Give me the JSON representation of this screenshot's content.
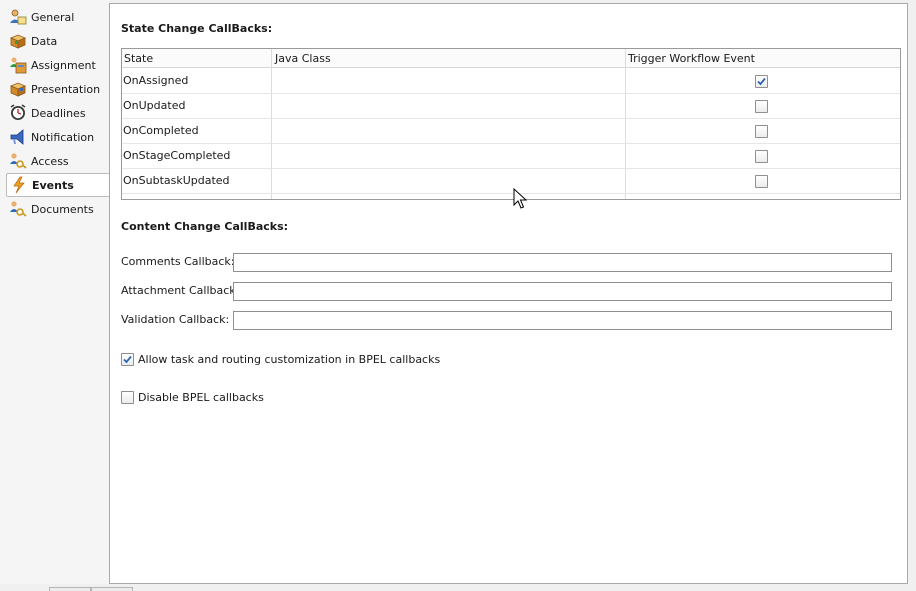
{
  "sidebar": {
    "items": [
      {
        "label": "General",
        "icon": "general-icon"
      },
      {
        "label": "Data",
        "icon": "data-icon"
      },
      {
        "label": "Assignment",
        "icon": "assignment-icon"
      },
      {
        "label": "Presentation",
        "icon": "presentation-icon"
      },
      {
        "label": "Deadlines",
        "icon": "deadlines-icon"
      },
      {
        "label": "Notification",
        "icon": "notification-icon"
      },
      {
        "label": "Access",
        "icon": "access-icon"
      },
      {
        "label": "Events",
        "icon": "events-icon",
        "active": true
      },
      {
        "label": "Documents",
        "icon": "documents-icon"
      }
    ]
  },
  "state_callbacks": {
    "title": "State Change CallBacks:",
    "columns": [
      "State",
      "Java Class",
      "Trigger Workflow Event"
    ],
    "rows": [
      {
        "state": "OnAssigned",
        "java_class": "",
        "trigger": true
      },
      {
        "state": "OnUpdated",
        "java_class": "",
        "trigger": false
      },
      {
        "state": "OnCompleted",
        "java_class": "",
        "trigger": false
      },
      {
        "state": "OnStageCompleted",
        "java_class": "",
        "trigger": false
      },
      {
        "state": "OnSubtaskUpdated",
        "java_class": "",
        "trigger": false
      }
    ]
  },
  "content_callbacks": {
    "title": "Content Change CallBacks:",
    "fields": [
      {
        "label": "Comments Callback:",
        "value": ""
      },
      {
        "label": "Attachment Callback:",
        "value": ""
      },
      {
        "label": "Validation Callback:",
        "value": ""
      }
    ]
  },
  "options": {
    "allow_customization": {
      "label": "Allow task and routing customization in BPEL callbacks",
      "checked": true
    },
    "disable_bpel": {
      "label": "Disable BPEL callbacks",
      "checked": false
    }
  },
  "colors": {
    "accent_check": "#2d64b4",
    "events_icon": "#f0a020"
  }
}
